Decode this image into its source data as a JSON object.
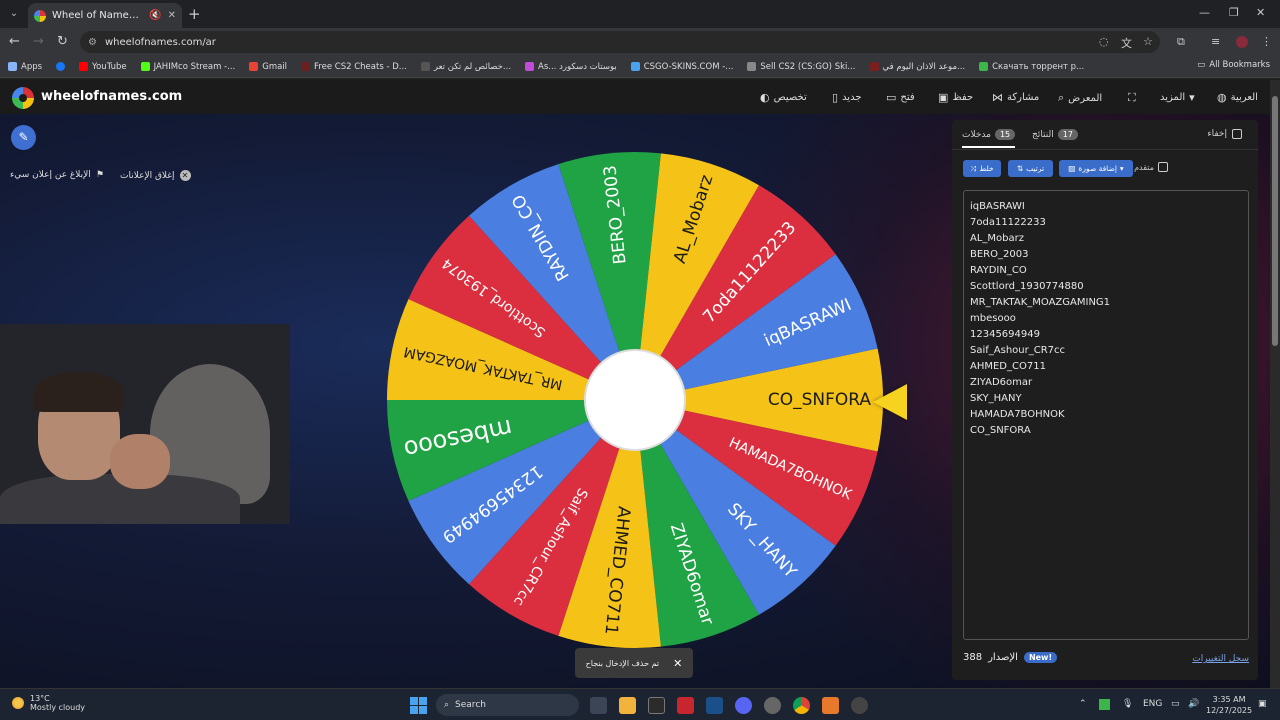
{
  "browser": {
    "tab_title": "Wheel of Names | العشوائي",
    "url": "wheelofnames.com/ar",
    "bookmarks": [
      {
        "label": "Apps",
        "color": "#8ab4f8"
      },
      {
        "label": "",
        "color": "#1877f2"
      },
      {
        "label": "YouTube",
        "color": "#ff0000"
      },
      {
        "label": "JAHIMco Stream -...",
        "color": "#53fc18"
      },
      {
        "label": "Gmail",
        "color": "#ea4335"
      },
      {
        "label": "Free CS2 Cheats - D...",
        "color": "#6b1f1f"
      },
      {
        "label": "خصائص لم تكن تعر...",
        "color": "#555555"
      },
      {
        "label": "As... بوستات دسكورد",
        "color": "#c04bd8"
      },
      {
        "label": "CSGO-SKINS.COM -...",
        "color": "#4aa3f0"
      },
      {
        "label": "Sell CS2 (CS:GO) Ski...",
        "color": "#888888"
      },
      {
        "label": "موعد الاذان اليوم في...",
        "color": "#7a1f1f"
      },
      {
        "label": "Скачать торрент р...",
        "color": "#3cb54a"
      }
    ],
    "all_bookmarks": "All Bookmarks"
  },
  "site": {
    "brand": "wheelofnames.com",
    "menu": {
      "customize": "تخصيص",
      "new": "جديد",
      "open": "فتح",
      "save": "حفظ",
      "share": "مشاركة",
      "gallery": "المعرض",
      "more": "المزيد",
      "language": "العربية"
    },
    "close_ads": "إغلاق الإعلانات",
    "report_ad": "الإبلاغ عن إعلان سيء"
  },
  "toast": {
    "text": "تم حذف الإدخال بنجاح"
  },
  "panel": {
    "tab_entries": "مدخلات",
    "entries_count": "15",
    "tab_results": "النتائج",
    "results_count": "17",
    "hide": "إخفاء",
    "shuffle": "خلط",
    "sort": "ترتيب",
    "add_image": "إضافة صورة",
    "advanced": "متقدم",
    "entries": [
      "iqBASRAWI",
      "7oda11122233",
      "AL_Mobarz",
      "BERO_2003",
      "RAYDIN_CO",
      "Scottlord_1930774880",
      "MR_TAKTAK_MOAZGAMING1",
      "mbesooo",
      "12345694949",
      "Saif_Ashour_CR7cc",
      "AHMED_CO711",
      "ZIYAD6omar",
      "SKY_HANY",
      "HAMADA7BOHNOK",
      "CO_SNFORA"
    ],
    "version_label": "الإصدار",
    "version_number": "388",
    "new_badge": "New!",
    "changelog": "سجل التغييرات"
  },
  "wheel": {
    "segments": [
      {
        "label": "CO_SNFORA",
        "color": "#f5c318"
      },
      {
        "label": "HAMADA7BOHNOK",
        "color": "#db2f3f"
      },
      {
        "label": "SKY _HANY",
        "color": "#4a7ee0"
      },
      {
        "label": "ZIYAD6omar",
        "color": "#1fa344"
      },
      {
        "label": "AHMED_CO711",
        "color": "#f5c318"
      },
      {
        "label": "Saif_Ashour_CR7cc",
        "color": "#db2f3f"
      },
      {
        "label": "12345694949",
        "color": "#4a7ee0"
      },
      {
        "label": "mbesooo",
        "color": "#1fa344"
      },
      {
        "label": "MR_TAKTAK_MOAZGAM",
        "color": "#f5c318"
      },
      {
        "label": "Scottlord_193074",
        "color": "#db2f3f"
      },
      {
        "label": "RAYDIN_CO",
        "color": "#4a7ee0"
      },
      {
        "label": "BERO_2003",
        "color": "#1fa344"
      },
      {
        "label": "AL_Mobarz",
        "color": "#f5c318"
      },
      {
        "label": "7oda11122233",
        "color": "#db2f3f"
      },
      {
        "label": "iqBASRAWI",
        "color": "#4a7ee0"
      }
    ]
  },
  "taskbar": {
    "temperature": "13°C",
    "weather": "Mostly cloudy",
    "search": "Search",
    "lang": "ENG",
    "time": "3:35 AM",
    "date": "12/27/2025"
  }
}
